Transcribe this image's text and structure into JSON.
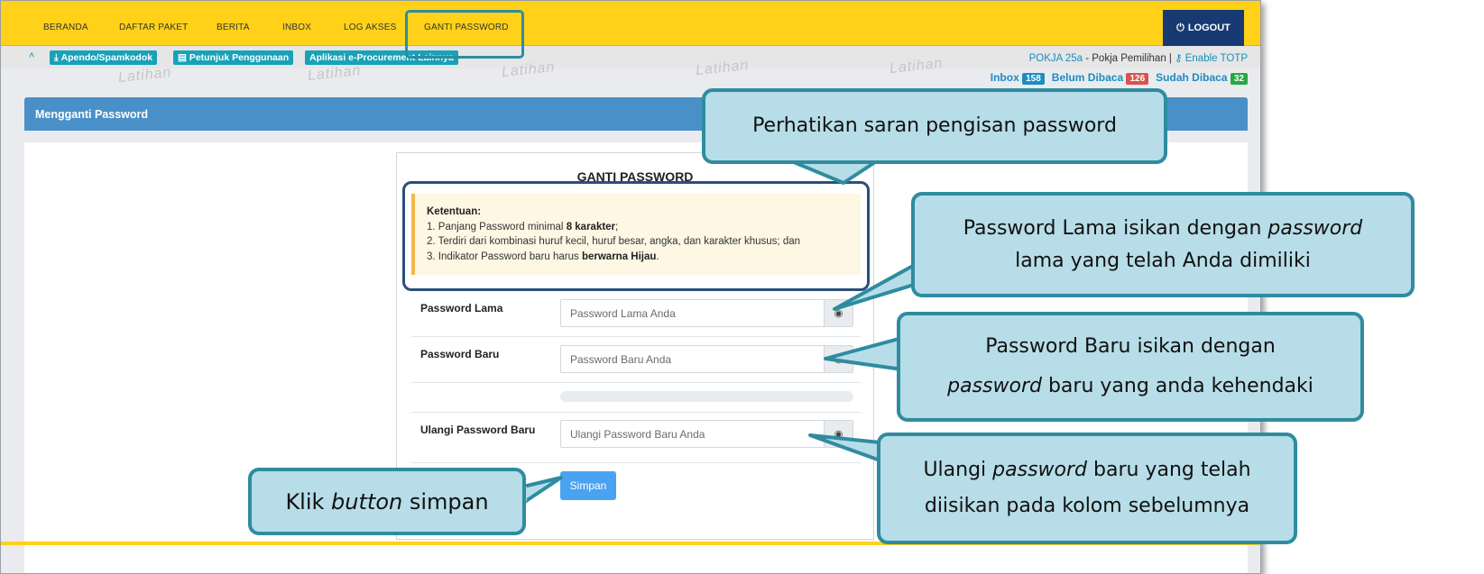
{
  "nav": {
    "items": [
      "BERANDA",
      "DAFTAR PAKET",
      "BERITA",
      "INBOX",
      "LOG AKSES",
      "GANTI PASSWORD"
    ],
    "logout": "LOGOUT"
  },
  "toolbar": {
    "buttons": [
      "Apendo/Spamkodok",
      "Petunjuk Penggunaan",
      "Aplikasi e-Procurement Lainnya"
    ],
    "pokja": "POKJA 25a",
    "pokja_role": " - Pokja Pemilihan | ",
    "totp": "Enable TOTP",
    "watermark": "Latihan"
  },
  "inbox": {
    "inbox_label": "Inbox",
    "inbox_count": "158",
    "unread_label": "Belum Dibaca",
    "unread_count": "126",
    "read_label": "Sudah Dibaca",
    "read_count": "32"
  },
  "panel": {
    "title": "Mengganti Password"
  },
  "form": {
    "title": "GANTI PASSWORD",
    "notice_title": "Ketentuan:",
    "rule1_prefix": "1. Panjang Password minimal ",
    "rule1_bold": "8 karakter",
    "rule1_suffix": ";",
    "rule2": "2. Terdiri dari kombinasi huruf kecil, huruf besar, angka, dan karakter khusus; dan",
    "rule3_prefix": "3. Indikator Password baru harus ",
    "rule3_bold": "berwarna Hijau",
    "rule3_suffix": ".",
    "old_label": "Password Lama",
    "old_placeholder": "Password Lama Anda",
    "new_label": "Password Baru",
    "new_placeholder": "Password Baru Anda",
    "repeat_label": "Ulangi Password Baru",
    "repeat_placeholder": "Ulangi Password Baru Anda",
    "submit": "Simpan"
  },
  "callouts": {
    "c1": "Perhatikan saran pengisan password",
    "c2_a": "Password Lama isikan dengan ",
    "c2_i": "password",
    "c2_b": "lama yang telah Anda dimiliki",
    "c3_a": "Password Baru isikan dengan",
    "c3_i": "password",
    "c3_b": " baru yang anda kehendaki",
    "c4_a": "Ulangi ",
    "c4_i": "password",
    "c4_b": " baru yang telah",
    "c4_c": "diisikan pada kolom sebelumnya",
    "c5_a": "Klik ",
    "c5_i": "button",
    "c5_b": " simpan"
  },
  "colors": {
    "nav_bg": "#ffd119",
    "logout_bg": "#173a72",
    "panel_head": "#4a90c8",
    "callout_fill": "#b7dde8",
    "callout_border": "#2f8ca0",
    "badge_blue": "#1b8ec0",
    "badge_red": "#d9534f",
    "badge_green": "#28a745"
  },
  "icons": [
    "chevron-up-icon",
    "download-icon",
    "book-icon",
    "power-icon",
    "key-icon",
    "eye-icon"
  ]
}
